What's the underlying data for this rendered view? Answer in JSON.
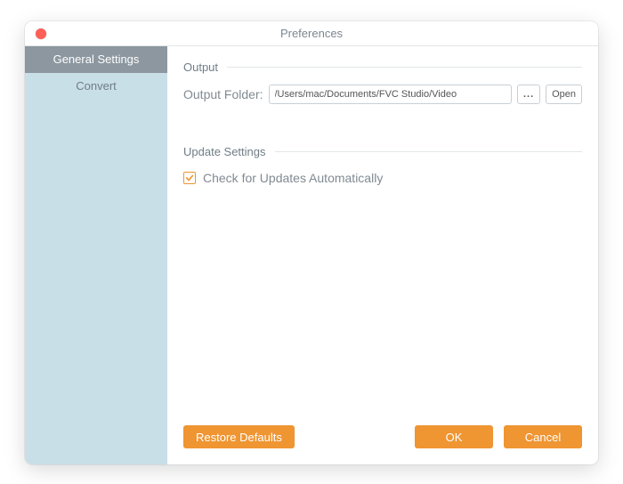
{
  "window": {
    "title": "Preferences"
  },
  "sidebar": {
    "items": [
      {
        "label": "General Settings"
      },
      {
        "label": "Convert"
      }
    ]
  },
  "output": {
    "section_label": "Output",
    "folder_label": "Output Folder:",
    "folder_path": "/Users/mac/Documents/FVC Studio/Video",
    "browse_glyph": "...",
    "open_label": "Open"
  },
  "update": {
    "section_label": "Update Settings",
    "check_label": "Check for Updates Automatically",
    "checked": true
  },
  "footer": {
    "restore_label": "Restore Defaults",
    "ok_label": "OK",
    "cancel_label": "Cancel"
  }
}
